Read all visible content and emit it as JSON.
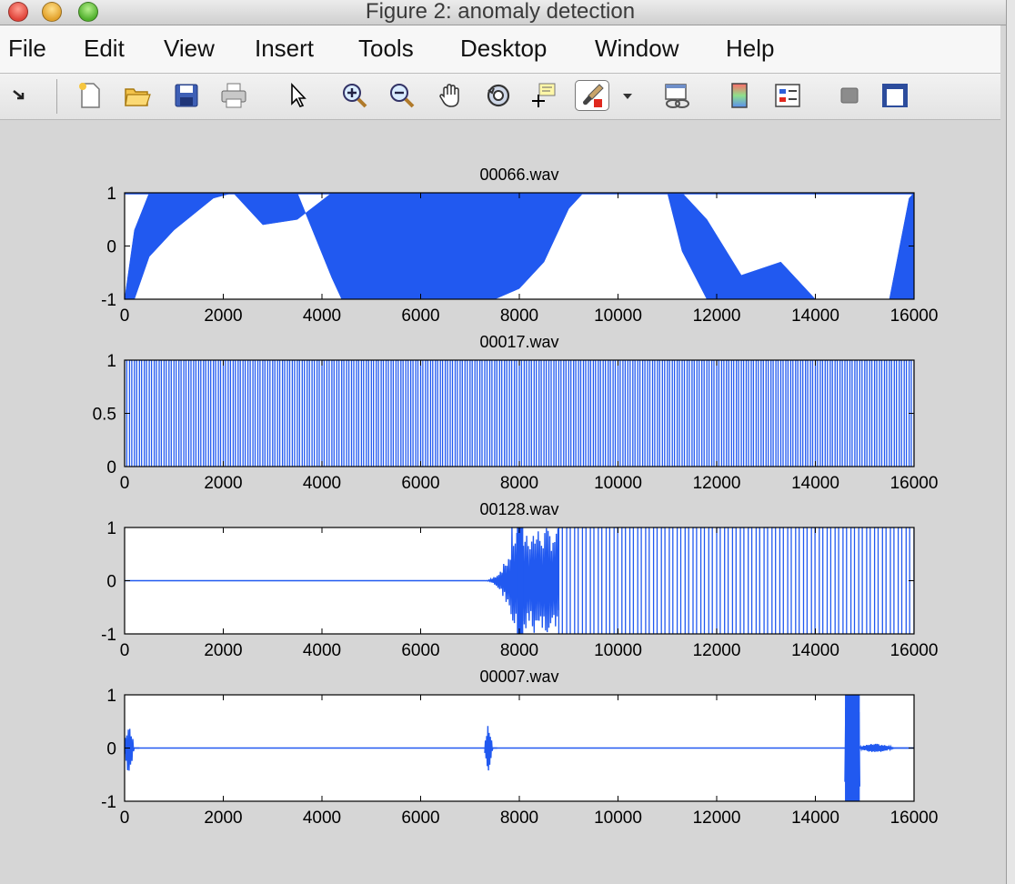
{
  "window": {
    "title": "Figure 2: anomaly detection"
  },
  "menu": [
    "File",
    "Edit",
    "View",
    "Insert",
    "Tools",
    "Desktop",
    "Window",
    "Help"
  ],
  "toolbar": {
    "icons": [
      "dock-arrow-icon",
      "new-figure-icon",
      "open-file-icon",
      "save-icon",
      "print-icon",
      "pointer-icon",
      "zoom-in-icon",
      "zoom-out-icon",
      "pan-hand-icon",
      "rotate-3d-icon",
      "data-cursor-icon",
      "brush-icon",
      "brush-dropdown-icon",
      "link-plot-icon",
      "colorbar-icon",
      "legend-icon",
      "hide-plot-tools-icon",
      "show-plot-tools-icon"
    ]
  },
  "colors": {
    "signal": "#2159f0",
    "background": "#d6d6d6"
  },
  "chart_data": [
    {
      "type": "line",
      "title": "00066.wav",
      "xlim": [
        0,
        16000
      ],
      "ylim": [
        -1,
        1
      ],
      "xticks": [
        0,
        2000,
        4000,
        6000,
        8000,
        10000,
        12000,
        14000,
        16000
      ],
      "yticks": [
        -1,
        0,
        1
      ],
      "envelope": {
        "x": [
          0,
          200,
          500,
          1000,
          1800,
          2200,
          2800,
          3500,
          4200,
          4400,
          4900,
          5500,
          6000,
          6500,
          7000,
          7500,
          8000,
          8500,
          9000,
          9300,
          10000,
          11000,
          11300,
          11800,
          12500,
          13300,
          14000,
          14500,
          15200,
          15500,
          15900,
          16000
        ],
        "upper": [
          -1,
          0.3,
          1,
          1,
          1,
          1,
          0.4,
          0.5,
          1,
          1,
          1,
          1,
          1,
          1,
          1,
          1,
          1,
          1,
          1,
          1,
          1,
          1,
          1,
          0.5,
          -0.55,
          -0.3,
          -1,
          -1,
          -1,
          -1,
          0.9,
          1
        ],
        "lower": [
          -1,
          -1,
          -0.2,
          0.3,
          0.9,
          1,
          1,
          1,
          -0.6,
          -1,
          -1,
          -1,
          -1,
          -1,
          -1,
          -1,
          -0.8,
          -0.3,
          0.7,
          1,
          1,
          1,
          -0.1,
          -1,
          -1,
          -1,
          -1,
          -1,
          -1,
          -1,
          -1,
          -1
        ]
      }
    },
    {
      "type": "line",
      "title": "00017.wav",
      "xlim": [
        0,
        16000
      ],
      "ylim": [
        0,
        1
      ],
      "xticks": [
        0,
        2000,
        4000,
        6000,
        8000,
        10000,
        12000,
        14000,
        16000
      ],
      "yticks": [
        0,
        0.5,
        1
      ],
      "pulses": {
        "period": 100,
        "min": 0,
        "max": 1,
        "start": 0,
        "end": 16000
      }
    },
    {
      "type": "line",
      "title": "00128.wav",
      "xlim": [
        0,
        16000
      ],
      "ylim": [
        -1,
        1
      ],
      "xticks": [
        0,
        2000,
        4000,
        6000,
        8000,
        10000,
        12000,
        14000,
        16000
      ],
      "yticks": [
        -1,
        0,
        1
      ],
      "flat": {
        "from": 0,
        "to": 7300,
        "y": 0
      },
      "burst": {
        "from": 7300,
        "to": 8800,
        "peak": 1
      },
      "pulses": {
        "period": 160,
        "min": -1,
        "max": 1,
        "start": 8800,
        "end": 16000
      }
    },
    {
      "type": "line",
      "title": "00007.wav",
      "xlim": [
        0,
        16000
      ],
      "ylim": [
        -1,
        1
      ],
      "xticks": [
        0,
        2000,
        4000,
        6000,
        8000,
        10000,
        12000,
        14000,
        16000
      ],
      "yticks": [
        -1,
        0,
        1
      ],
      "baseline": 0,
      "bursts": [
        {
          "from": 0,
          "to": 300,
          "amp": 0.45
        },
        {
          "from": 7300,
          "to": 7550,
          "amp": 0.45
        },
        {
          "from": 14600,
          "to": 14900,
          "amp": 1
        },
        {
          "from": 14900,
          "to": 16000,
          "amp": 0.08
        }
      ]
    }
  ]
}
